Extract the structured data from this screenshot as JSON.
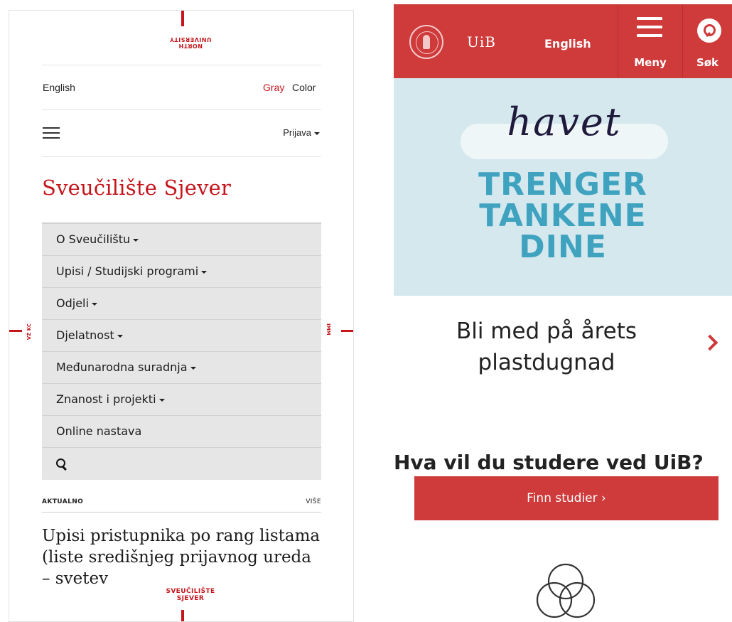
{
  "left": {
    "logo_top_lines": [
      "NORTH",
      "UNIVERSITY"
    ],
    "logo_bottom_lines": [
      "SVEUČILIŠTE",
      "SJEVER"
    ],
    "side_left_text": "VŽ KC",
    "side_right_text": "IMM",
    "lang_link": "English",
    "mode_gray": "Gray",
    "mode_color": "Color",
    "login": "Prijava",
    "title": "Sveučilište Sjever",
    "menu": [
      {
        "label": "O Sveučilištu",
        "dropdown": true
      },
      {
        "label": "Upisi / Studijski programi",
        "dropdown": true
      },
      {
        "label": "Odjeli",
        "dropdown": true
      },
      {
        "label": "Djelatnost",
        "dropdown": true
      },
      {
        "label": "Međunarodna suradnja",
        "dropdown": true
      },
      {
        "label": "Znanost i projekti",
        "dropdown": true
      },
      {
        "label": "Online nastava",
        "dropdown": false
      }
    ],
    "section_label": "AKTUALNO",
    "section_more": "VIŠE",
    "news_title": "Upisi pristupnika po rang listama (liste središnjeg prijavnog ureda – svetev"
  },
  "right": {
    "brand": "UiB",
    "lang_link": "English",
    "menu_label": "Meny",
    "search_label": "Søk",
    "hero": {
      "script_word": "havet",
      "lines": [
        "TRENGER",
        "TANKENE",
        "DINE"
      ]
    },
    "cta_text": "Bli med på årets plastdugnad",
    "question": "Hva vil du studere ved UiB?",
    "button_label": "Finn studier ›"
  },
  "colors": {
    "left_accent": "#c4161c",
    "uib_red": "#cf3a3a",
    "hero_bg": "#d4e8ee",
    "hero_text": "#3fa3c0",
    "menu_bg": "#e6e6e6"
  }
}
